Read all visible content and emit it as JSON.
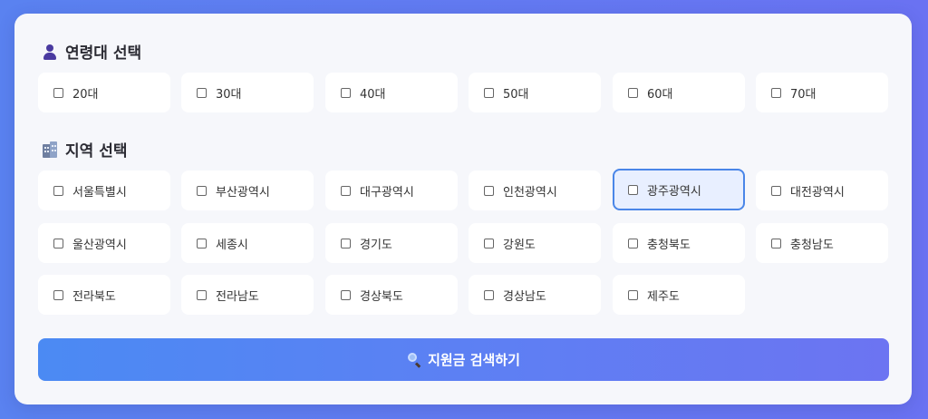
{
  "age_section": {
    "icon": "person-icon",
    "title": "연령대 선택",
    "options": [
      {
        "label": "20대",
        "checked": false
      },
      {
        "label": "30대",
        "checked": false
      },
      {
        "label": "40대",
        "checked": false
      },
      {
        "label": "50대",
        "checked": false
      },
      {
        "label": "60대",
        "checked": false
      },
      {
        "label": "70대",
        "checked": false
      }
    ]
  },
  "region_section": {
    "icon": "building-icon",
    "title": "지역 선택",
    "options": [
      {
        "label": "서울특별시",
        "checked": false
      },
      {
        "label": "부산광역시",
        "checked": false
      },
      {
        "label": "대구광역시",
        "checked": false
      },
      {
        "label": "인천광역시",
        "checked": false
      },
      {
        "label": "광주광역시",
        "checked": false,
        "highlighted": true
      },
      {
        "label": "대전광역시",
        "checked": false
      },
      {
        "label": "울산광역시",
        "checked": false
      },
      {
        "label": "세종시",
        "checked": false
      },
      {
        "label": "경기도",
        "checked": false
      },
      {
        "label": "강원도",
        "checked": false
      },
      {
        "label": "충청북도",
        "checked": false
      },
      {
        "label": "충청남도",
        "checked": false
      },
      {
        "label": "전라북도",
        "checked": false
      },
      {
        "label": "전라남도",
        "checked": false
      },
      {
        "label": "경상북도",
        "checked": false
      },
      {
        "label": "경상남도",
        "checked": false
      },
      {
        "label": "제주도",
        "checked": false
      }
    ]
  },
  "search_button": {
    "icon": "magnifier-icon",
    "label": "지원금 검색하기"
  },
  "colors": {
    "accent": "#4a86e8",
    "background_gradient_start": "#5a82f0",
    "background_gradient_end": "#6a72f2"
  }
}
